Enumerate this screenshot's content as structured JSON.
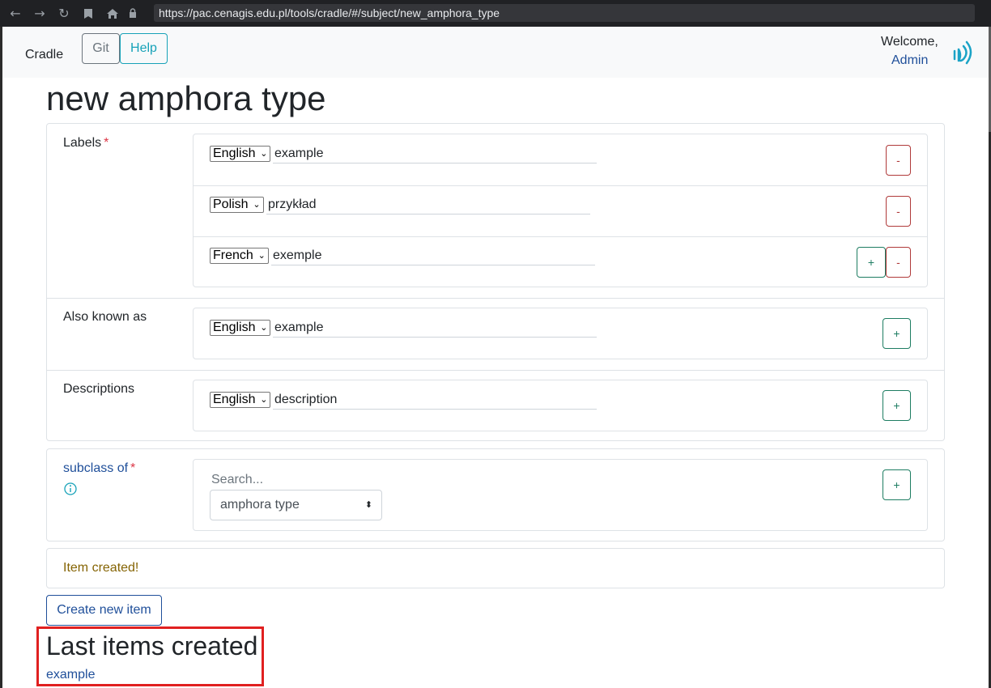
{
  "browser": {
    "url": "https://pac.cenagis.edu.pl/tools/cradle/#/subject/new_amphora_type"
  },
  "header": {
    "brand": "Cradle",
    "git_label": "Git",
    "help_label": "Help",
    "welcome": "Welcome,",
    "user": "Admin"
  },
  "page_title": "new amphora type",
  "labels": {
    "title": "Labels",
    "required_mark": "*",
    "rows": [
      {
        "lang": "English",
        "value": "example",
        "minus": "-"
      },
      {
        "lang": "Polish",
        "value": "przykład",
        "minus": "-"
      },
      {
        "lang": "French",
        "value": "exemple",
        "minus": "-",
        "plus": "+"
      }
    ]
  },
  "also_known_as": {
    "title": "Also known as",
    "lang": "English",
    "value": "example",
    "plus": "+"
  },
  "descriptions": {
    "title": "Descriptions",
    "lang": "English",
    "value": "description",
    "plus": "+"
  },
  "subclass": {
    "title": "subclass of",
    "required_mark": "*",
    "search_placeholder": "Search...",
    "selected": "amphora type",
    "plus": "+"
  },
  "alert": {
    "text": "Item created!"
  },
  "create_button": "Create new item",
  "last_items": {
    "title": "Last items created",
    "items": [
      "example"
    ]
  },
  "colors": {
    "link": "#1f4f9a",
    "danger": "#b03a3a",
    "success": "#1e7d62",
    "info": "#17a2b8",
    "highlight": "#e02020"
  }
}
